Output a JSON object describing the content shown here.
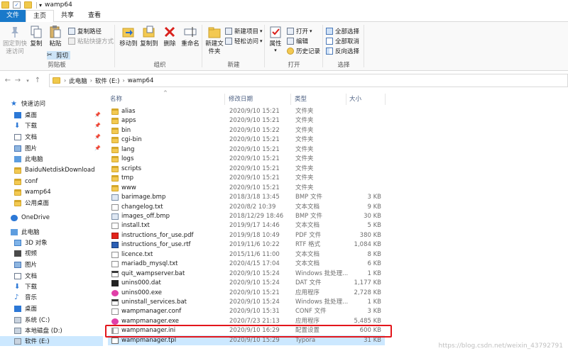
{
  "window": {
    "title": "wamp64"
  },
  "tabs": [
    "文件",
    "主页",
    "共享",
    "查看"
  ],
  "ribbon": {
    "clipboard": {
      "label": "剪贴板",
      "pin_label": "固定到快速访问",
      "copy": "复制",
      "paste": "粘贴",
      "copy_path": "复制路径",
      "paste_shortcut": "粘贴快捷方式",
      "cut": "剪切"
    },
    "organize": {
      "label": "组织",
      "move_to": "移动到",
      "copy_to": "复制到",
      "delete": "删除",
      "rename": "重命名"
    },
    "new": {
      "label": "新建",
      "new_folder": "新建文件夹",
      "new_item": "新建项目",
      "easy_access": "轻松访问"
    },
    "open": {
      "label": "打开",
      "properties": "属性",
      "open": "打开",
      "edit": "编辑",
      "history": "历史记录"
    },
    "select": {
      "label": "选择",
      "select_all": "全部选择",
      "select_none": "全部取消",
      "invert": "反向选择"
    }
  },
  "address": {
    "crumbs": [
      "此电脑",
      "软件 (E:)",
      "wamp64"
    ]
  },
  "nav": {
    "quick_access": "快速访问",
    "pinned": [
      "桌面",
      "下载",
      "文档",
      "图片"
    ],
    "recent": [
      "此电脑",
      "BaiduNetdiskDownload",
      "conf",
      "wamp64",
      "公用桌面"
    ],
    "onedrive": "OneDrive",
    "this_pc": "此电脑",
    "pc_items": [
      "3D 对象",
      "视频",
      "图片",
      "文档",
      "下载",
      "音乐",
      "桌面",
      "系统 (C:)",
      "本地磁盘 (D:)",
      "软件 (E:)"
    ]
  },
  "columns": {
    "name": "名称",
    "date": "修改日期",
    "type": "类型",
    "size": "大小"
  },
  "files": [
    {
      "name": "alias",
      "date": "2020/9/10 15:21",
      "type": "文件夹",
      "size": "",
      "icon": "folder"
    },
    {
      "name": "apps",
      "date": "2020/9/10 15:21",
      "type": "文件夹",
      "size": "",
      "icon": "folder"
    },
    {
      "name": "bin",
      "date": "2020/9/10 15:22",
      "type": "文件夹",
      "size": "",
      "icon": "folder"
    },
    {
      "name": "cgi-bin",
      "date": "2020/9/10 15:21",
      "type": "文件夹",
      "size": "",
      "icon": "folder"
    },
    {
      "name": "lang",
      "date": "2020/9/10 15:21",
      "type": "文件夹",
      "size": "",
      "icon": "folder"
    },
    {
      "name": "logs",
      "date": "2020/9/10 15:21",
      "type": "文件夹",
      "size": "",
      "icon": "folder"
    },
    {
      "name": "scripts",
      "date": "2020/9/10 15:21",
      "type": "文件夹",
      "size": "",
      "icon": "folder"
    },
    {
      "name": "tmp",
      "date": "2020/9/10 15:21",
      "type": "文件夹",
      "size": "",
      "icon": "folder"
    },
    {
      "name": "www",
      "date": "2020/9/10 15:21",
      "type": "文件夹",
      "size": "",
      "icon": "folder"
    },
    {
      "name": "barimage.bmp",
      "date": "2018/3/18 13:45",
      "type": "BMP 文件",
      "size": "3 KB",
      "icon": "bmp"
    },
    {
      "name": "changelog.txt",
      "date": "2020/8/2 10:39",
      "type": "文本文档",
      "size": "9 KB",
      "icon": "file"
    },
    {
      "name": "images_off.bmp",
      "date": "2018/12/29 18:46",
      "type": "BMP 文件",
      "size": "30 KB",
      "icon": "bmp"
    },
    {
      "name": "install.txt",
      "date": "2019/9/17 14:46",
      "type": "文本文档",
      "size": "5 KB",
      "icon": "file"
    },
    {
      "name": "instructions_for_use.pdf",
      "date": "2019/9/18 10:49",
      "type": "PDF 文件",
      "size": "380 KB",
      "icon": "pdf"
    },
    {
      "name": "instructions_for_use.rtf",
      "date": "2019/11/6 10:22",
      "type": "RTF 格式",
      "size": "1,084 KB",
      "icon": "rtf"
    },
    {
      "name": "licence.txt",
      "date": "2015/11/6 11:00",
      "type": "文本文档",
      "size": "8 KB",
      "icon": "file"
    },
    {
      "name": "mariadb_mysql.txt",
      "date": "2020/4/15 17:04",
      "type": "文本文档",
      "size": "6 KB",
      "icon": "file"
    },
    {
      "name": "quit_wampserver.bat",
      "date": "2020/9/10 15:24",
      "type": "Windows 批处理...",
      "size": "1 KB",
      "icon": "bat"
    },
    {
      "name": "unins000.dat",
      "date": "2020/9/10 15:24",
      "type": "DAT 文件",
      "size": "1,177 KB",
      "icon": "dat"
    },
    {
      "name": "unins000.exe",
      "date": "2020/9/10 15:21",
      "type": "应用程序",
      "size": "2,728 KB",
      "icon": "exe"
    },
    {
      "name": "uninstall_services.bat",
      "date": "2020/9/10 15:24",
      "type": "Windows 批处理...",
      "size": "1 KB",
      "icon": "bat"
    },
    {
      "name": "wampmanager.conf",
      "date": "2020/9/10 15:31",
      "type": "CONF 文件",
      "size": "3 KB",
      "icon": "file"
    },
    {
      "name": "wampmanager.exe",
      "date": "2020/7/23 21:13",
      "type": "应用程序",
      "size": "5,485 KB",
      "icon": "exe"
    },
    {
      "name": "wampmanager.ini",
      "date": "2020/9/10 16:29",
      "type": "配置设置",
      "size": "600 KB",
      "icon": "ini"
    },
    {
      "name": "wampmanager.tpl",
      "date": "2020/9/10 15:29",
      "type": "Typora",
      "size": "31 KB",
      "icon": "tpl"
    }
  ],
  "watermark": "https://blog.csdn.net/weixin_43792791",
  "colors": {
    "file_tab": "#1979ca",
    "selection": "#cce8ff",
    "highlight_box": "#e3161b"
  }
}
